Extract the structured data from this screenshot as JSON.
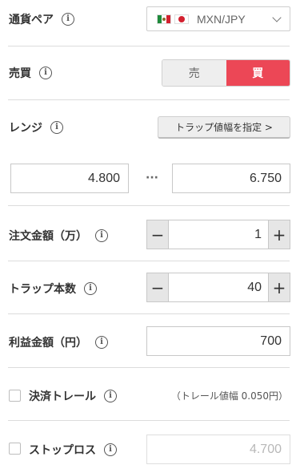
{
  "pair": {
    "label": "通貨ペア",
    "value": "MXN/JPY",
    "base_flag": "mexico-flag-icon",
    "quote_flag": "japan-flag-icon"
  },
  "side": {
    "label": "売買",
    "sell_label": "売",
    "buy_label": "買",
    "selected": "買",
    "accent": "#ec4756"
  },
  "range": {
    "label": "レンジ",
    "trap_button_label": "トラップ値幅を指定 >",
    "min_value": "4.800",
    "separator": "···",
    "max_value": "6.750"
  },
  "amount": {
    "label": "注文金額（万）",
    "minus": "−",
    "plus": "+",
    "value": "1"
  },
  "trap_count": {
    "label": "トラップ本数",
    "minus": "−",
    "plus": "+",
    "value": "40"
  },
  "profit": {
    "label": "利益金額（円）",
    "value": "700"
  },
  "trailing": {
    "label": "決済トレール",
    "note": "（トレール値幅 0.050円）",
    "checked": false
  },
  "stoploss": {
    "label": "ストップロス",
    "placeholder": "4.700",
    "checked": false
  },
  "info_glyph": "i"
}
